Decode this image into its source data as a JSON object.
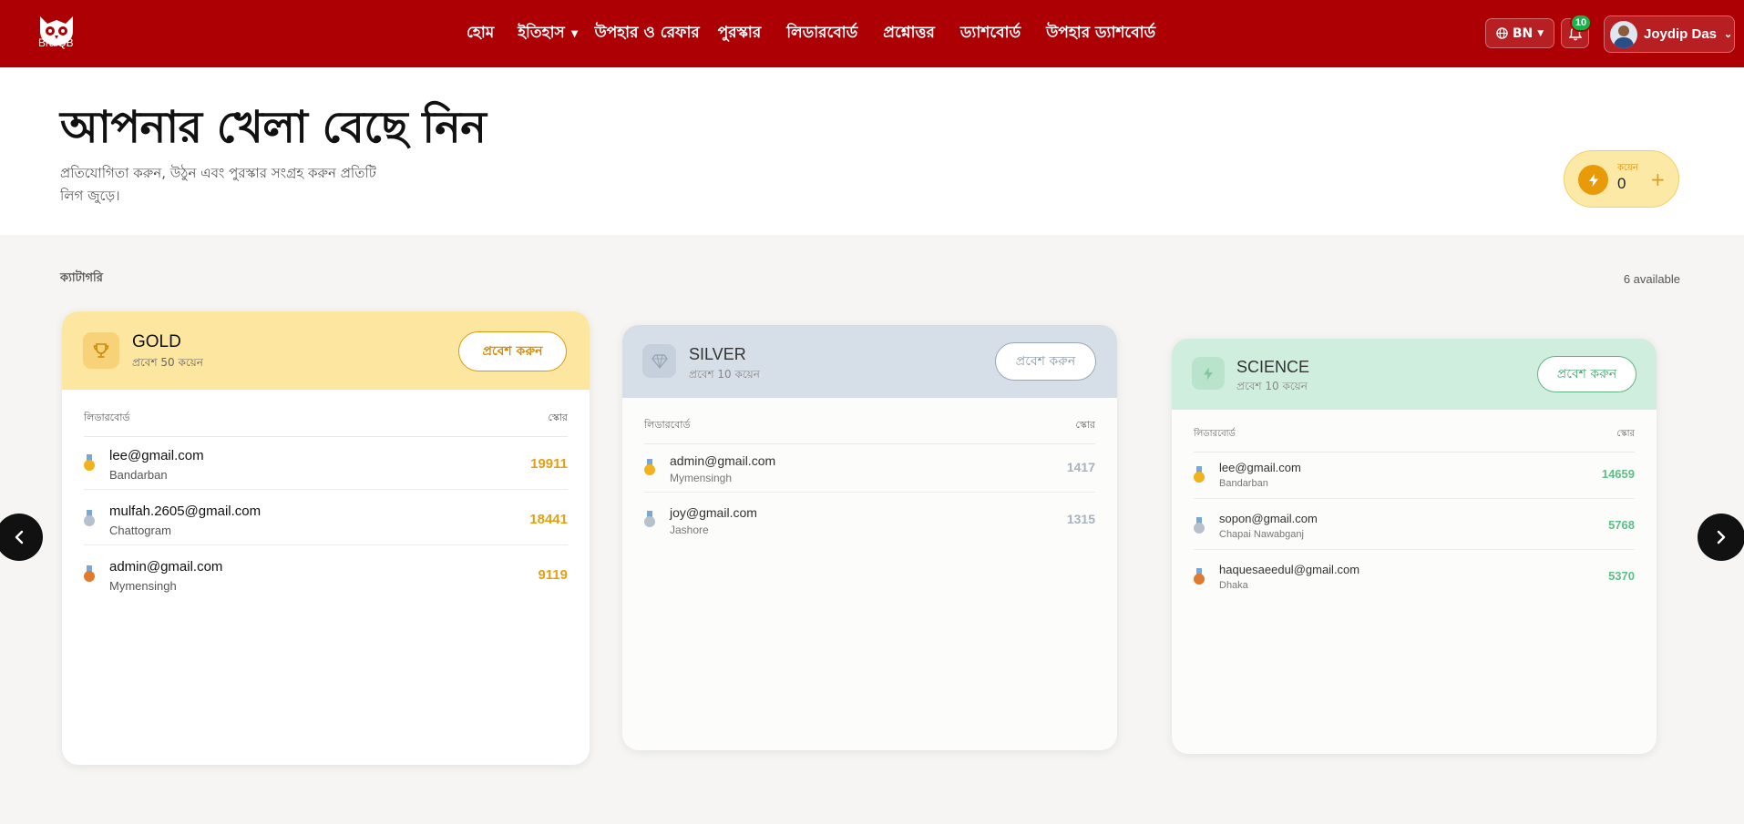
{
  "nav": {
    "logo_text": "BraiQB",
    "links": [
      {
        "label": "হোম"
      },
      {
        "label": "ইতিহাস"
      },
      {
        "label": "উপহার ও রেফার"
      },
      {
        "label": "পুরস্কার"
      },
      {
        "label": "লিডারবোর্ড"
      },
      {
        "label": "প্রশ্নোত্তর"
      },
      {
        "label": "ড্যাশবোর্ড"
      },
      {
        "label": "উপহার ড্যাশবোর্ড"
      }
    ],
    "lang": "BN",
    "notification_count": "10",
    "user_name": "Joydip Das"
  },
  "hero": {
    "title": "আপনার খেলা বেছে নিন",
    "subtitle": "প্রতিযোগিতা করুন, উঠুন এবং পুরস্কার সংগ্রহ করুন প্রতিটি লিগ জুড়ে।",
    "coin_label": "কয়েন",
    "coin_value": "0",
    "coin_plus": "+"
  },
  "section": {
    "label": "ক্যাটাগরি",
    "available": "6 available"
  },
  "cards": [
    {
      "name": "GOLD",
      "entry": "প্রবেশ 50 কয়েন",
      "button": "প্রবেশ করুন",
      "lb_label": "লিডারবোর্ড",
      "score_label": "স্কোর",
      "rows": [
        {
          "email": "lee@gmail.com",
          "city": "Bandarban",
          "score": "19911"
        },
        {
          "email": "mulfah.2605@gmail.com",
          "city": "Chattogram",
          "score": "18441"
        },
        {
          "email": "admin@gmail.com",
          "city": "Mymensingh",
          "score": "9119"
        }
      ]
    },
    {
      "name": "SILVER",
      "entry": "প্রবেশ 10 কয়েন",
      "button": "প্রবেশ করুন",
      "lb_label": "লিডারবোর্ড",
      "score_label": "স্কোর",
      "rows": [
        {
          "email": "admin@gmail.com",
          "city": "Mymensingh",
          "score": "1417"
        },
        {
          "email": "joy@gmail.com",
          "city": "Jashore",
          "score": "1315"
        }
      ]
    },
    {
      "name": "SCIENCE",
      "entry": "প্রবেশ 10 কয়েন",
      "button": "প্রবেশ করুন",
      "lb_label": "লিডারবোর্ড",
      "score_label": "স্কোর",
      "rows": [
        {
          "email": "lee@gmail.com",
          "city": "Bandarban",
          "score": "14659"
        },
        {
          "email": "sopon@gmail.com",
          "city": "Chapai Nawabganj",
          "score": "5768"
        },
        {
          "email": "haquesaeedul@gmail.com",
          "city": "Dhaka",
          "score": "5370"
        }
      ]
    }
  ],
  "colors": {
    "nav_bg": "#ad0004",
    "gold_head": "#fde6a0",
    "silver_head": "#d6dee8",
    "science_head": "#cfeedd",
    "medal_gold": "#f1b21c",
    "medal_silver": "#b7c1cc",
    "medal_bronze": "#e07a2e"
  },
  "icons": {
    "logo": "owl-logo",
    "lang": "globe-icon",
    "bell": "bell-icon",
    "coin": "bolt-icon",
    "gold": "trophy-icon",
    "silver": "diamond-icon",
    "science": "bolt-icon",
    "prev": "chevron-left-icon",
    "next": "chevron-right-icon"
  }
}
